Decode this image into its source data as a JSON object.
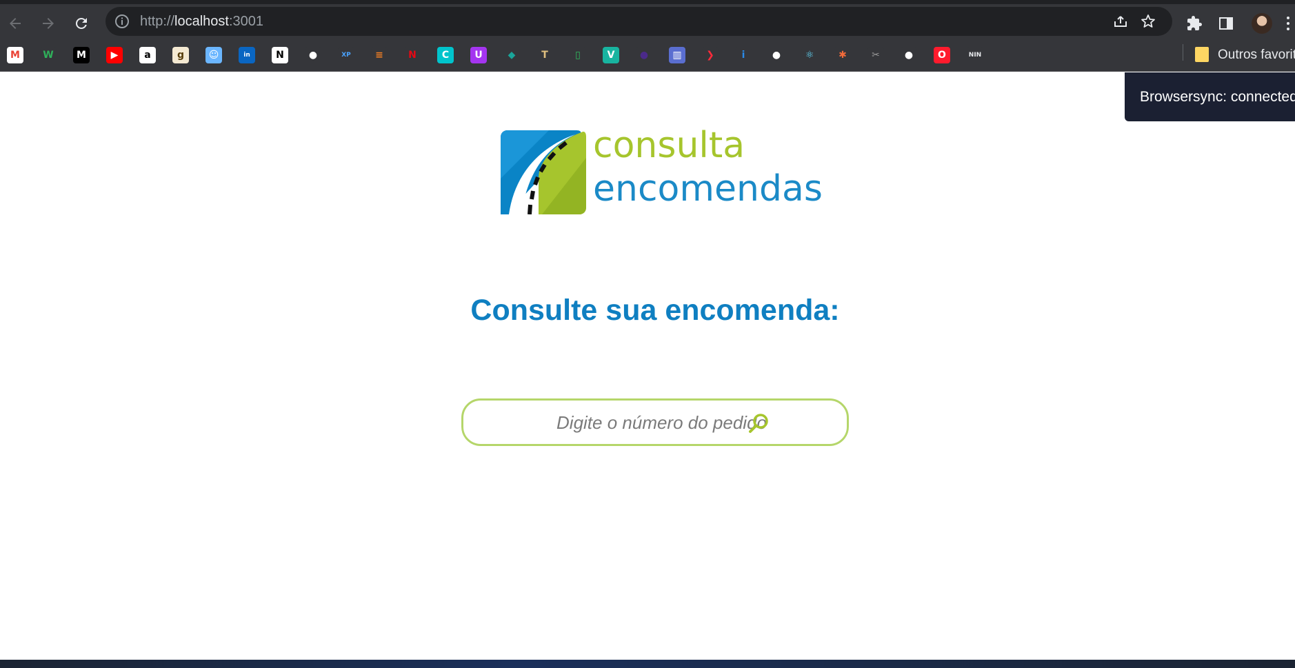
{
  "browser": {
    "url_scheme": "http://",
    "url_host": "localhost",
    "url_port": ":3001",
    "bookmarks": [
      {
        "name": "gmail",
        "glyph": "M",
        "bg": "#ffffff",
        "fg": "#ea4335"
      },
      {
        "name": "wakatime",
        "glyph": "W",
        "bg": "#35363a",
        "fg": "#2fb15a"
      },
      {
        "name": "medium",
        "glyph": "M",
        "bg": "#000000",
        "fg": "#ffffff"
      },
      {
        "name": "youtube",
        "glyph": "▶",
        "bg": "#ff0000",
        "fg": "#ffffff"
      },
      {
        "name": "amazon",
        "glyph": "a",
        "bg": "#ffffff",
        "fg": "#000000"
      },
      {
        "name": "goodreads",
        "glyph": "g",
        "bg": "#f4e9d2",
        "fg": "#553b08"
      },
      {
        "name": "face",
        "glyph": "☺",
        "bg": "#6bb6ff",
        "fg": "#ffffff"
      },
      {
        "name": "linkedin",
        "glyph": "in",
        "bg": "#0a66c2",
        "fg": "#ffffff"
      },
      {
        "name": "notion",
        "glyph": "N",
        "bg": "#ffffff",
        "fg": "#000000"
      },
      {
        "name": "github",
        "glyph": "●",
        "bg": "#35363a",
        "fg": "#ffffff"
      },
      {
        "name": "xp",
        "glyph": "XP",
        "bg": "#35363a",
        "fg": "#4aa3ff"
      },
      {
        "name": "stackoverflow",
        "glyph": "≡",
        "bg": "#35363a",
        "fg": "#f48024"
      },
      {
        "name": "netflix",
        "glyph": "N",
        "bg": "#35363a",
        "fg": "#e50914"
      },
      {
        "name": "canva",
        "glyph": "C",
        "bg": "#00c4cc",
        "fg": "#ffffff"
      },
      {
        "name": "udemy",
        "glyph": "U",
        "bg": "#a435f0",
        "fg": "#ffffff"
      },
      {
        "name": "diamond",
        "glyph": "◆",
        "bg": "#35363a",
        "fg": "#1aa59a"
      },
      {
        "name": "hammer",
        "glyph": "T",
        "bg": "#35363a",
        "fg": "#e0c080"
      },
      {
        "name": "green-doc",
        "glyph": "▯",
        "bg": "#35363a",
        "fg": "#2fbf5f"
      },
      {
        "name": "vue",
        "glyph": "V",
        "bg": "#18b4a0",
        "fg": "#ffffff"
      },
      {
        "name": "purple-circle",
        "glyph": "●",
        "bg": "#35363a",
        "fg": "#4b2a8a"
      },
      {
        "name": "trello",
        "glyph": "▥",
        "bg": "#5a6ed0",
        "fg": "#ffffff"
      },
      {
        "name": "red-arrow",
        "glyph": "❯",
        "bg": "#35363a",
        "fg": "#ff2a3a"
      },
      {
        "name": "info",
        "glyph": "i",
        "bg": "#35363a",
        "fg": "#2a8ae8"
      },
      {
        "name": "github-2",
        "glyph": "●",
        "bg": "#35363a",
        "fg": "#ffffff"
      },
      {
        "name": "react",
        "glyph": "⚛",
        "bg": "#35363a",
        "fg": "#61dafb"
      },
      {
        "name": "asterisk",
        "glyph": "✱",
        "bg": "#35363a",
        "fg": "#f26b3a"
      },
      {
        "name": "tools",
        "glyph": "✂",
        "bg": "#35363a",
        "fg": "#9a9a9a"
      },
      {
        "name": "github-3",
        "glyph": "●",
        "bg": "#35363a",
        "fg": "#ffffff"
      },
      {
        "name": "opera",
        "glyph": "O",
        "bg": "#ff1b2d",
        "fg": "#ffffff"
      },
      {
        "name": "nin",
        "glyph": "NIN",
        "bg": "#35363a",
        "fg": "#e8eaed"
      }
    ],
    "other_bookmarks": "Outros favoritos"
  },
  "toast": {
    "text": "Browsersync: connected"
  },
  "logo": {
    "line1": "consulta",
    "line2": "encomendas"
  },
  "page": {
    "heading": "Consulte sua encomenda:",
    "search_placeholder": "Digite o número do pedido"
  },
  "colors": {
    "brand_blue": "#0f7fc1",
    "brand_green": "#a6c52d",
    "search_border": "#b5d66a"
  }
}
